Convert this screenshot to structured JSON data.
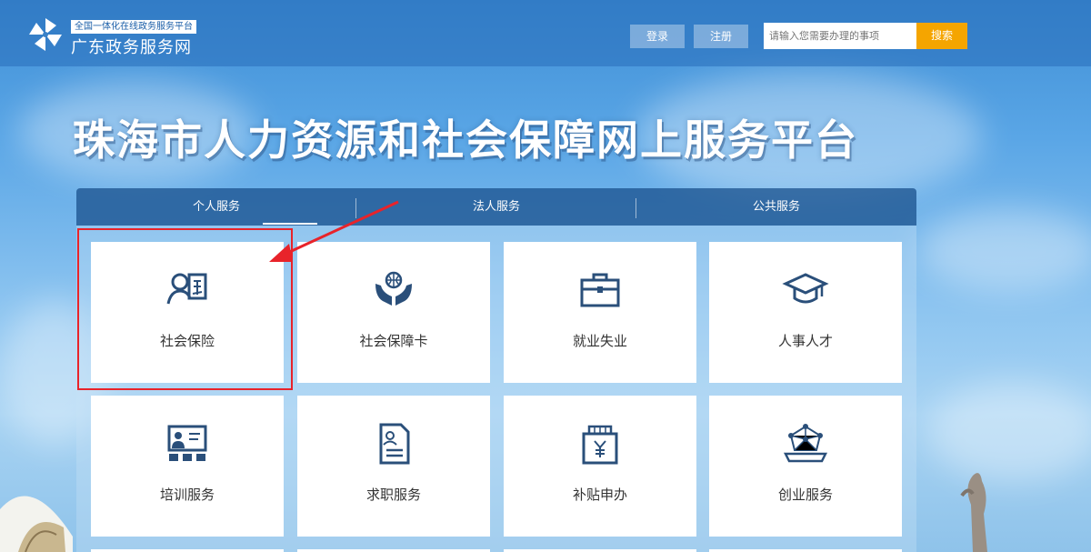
{
  "header": {
    "logo_subtitle": "全国一体化在线政务服务平台",
    "logo_title": "广东政务服务网",
    "login_label": "登录",
    "register_label": "注册",
    "search_placeholder": "请输入您需要办理的事项",
    "search_label": "搜索"
  },
  "hero": {
    "title": "珠海市人力资源和社会保障网上服务平台"
  },
  "tabs": [
    {
      "label": "个人服务",
      "active": true
    },
    {
      "label": "法人服务",
      "active": false
    },
    {
      "label": "公共服务",
      "active": false
    }
  ],
  "services": [
    {
      "label": "社会保险",
      "icon": "social-insurance-icon"
    },
    {
      "label": "社会保障卡",
      "icon": "social-security-card-icon"
    },
    {
      "label": "就业失业",
      "icon": "briefcase-icon"
    },
    {
      "label": "人事人才",
      "icon": "graduation-cap-icon"
    },
    {
      "label": "培训服务",
      "icon": "training-board-icon"
    },
    {
      "label": "求职服务",
      "icon": "resume-document-icon"
    },
    {
      "label": "补贴申办",
      "icon": "subsidy-book-icon"
    },
    {
      "label": "创业服务",
      "icon": "startup-network-icon"
    }
  ],
  "colors": {
    "icon": "#2a4f7a",
    "accent": "#f5a500",
    "highlight": "#e8232a"
  }
}
